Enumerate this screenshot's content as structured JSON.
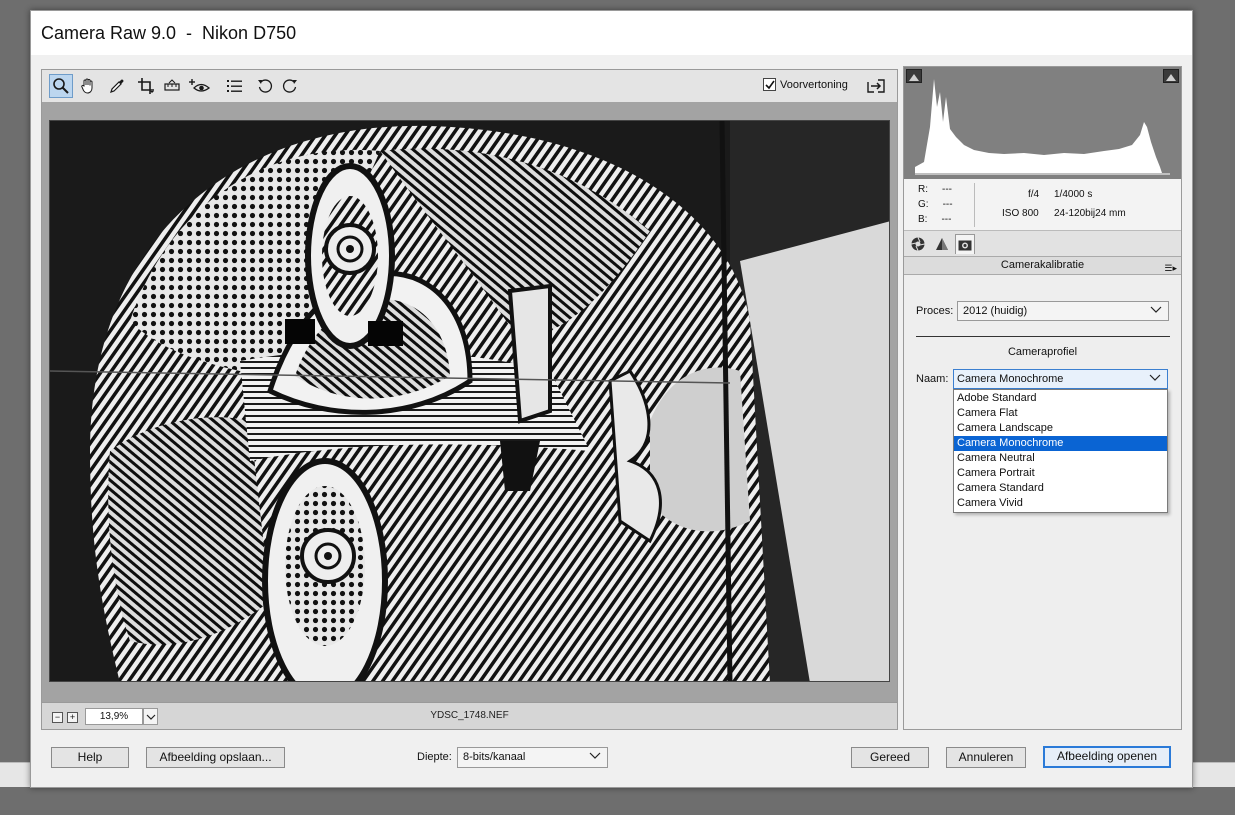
{
  "window": {
    "title": "Camera Raw 9.0  -  Nikon D750"
  },
  "toolbar": {
    "tools": [
      {
        "name": "zoom-tool",
        "icon": "magnifier-icon",
        "active": true
      },
      {
        "name": "hand-tool",
        "icon": "hand-icon"
      },
      {
        "name": "white-balance-tool",
        "icon": "eyedropper-icon"
      },
      {
        "name": "crop-tool",
        "icon": "crop-icon"
      },
      {
        "name": "straighten-tool",
        "icon": "level-icon"
      },
      {
        "name": "red-eye-tool",
        "icon": "eye-icon"
      },
      {
        "name": "preferences-tool",
        "icon": "list-icon"
      },
      {
        "name": "rotate-left-tool",
        "icon": "rotate-ccw-icon"
      },
      {
        "name": "rotate-right-tool",
        "icon": "rotate-cw-icon"
      }
    ],
    "preview_label": "Voorvertoning",
    "preview_checked": true
  },
  "status": {
    "zoom_value": "13,9%",
    "filename": "YDSC_1748.NEF"
  },
  "info": {
    "r_label": "R:",
    "r_value": "---",
    "g_label": "G:",
    "g_value": "---",
    "b_label": "B:",
    "b_value": "---",
    "aperture": "f/4",
    "shutter": "1/4000 s",
    "iso": "ISO 800",
    "focal": "24-120bij24 mm"
  },
  "panel": {
    "title": "Camerakalibratie",
    "proces_label": "Proces:",
    "proces_value": "2012 (huidig)",
    "profile_title": "Cameraprofiel",
    "naam_label": "Naam:",
    "naam_value": "Camera Monochrome",
    "options": [
      "Adobe Standard",
      "Camera Flat",
      "Camera Landscape",
      "Camera Monochrome",
      "Camera Neutral",
      "Camera Portrait",
      "Camera Standard",
      "Camera Vivid"
    ],
    "selected_index": 3
  },
  "bottom": {
    "help_label": "Help",
    "save_label": "Afbeelding opslaan...",
    "depth_label": "Diepte:",
    "depth_value": "8-bits/kanaal",
    "done_label": "Gereed",
    "cancel_label": "Annuleren",
    "open_label": "Afbeelding openen"
  },
  "colors": {
    "accent": "#0a64d3",
    "primary_border": "#2a7ad8"
  }
}
